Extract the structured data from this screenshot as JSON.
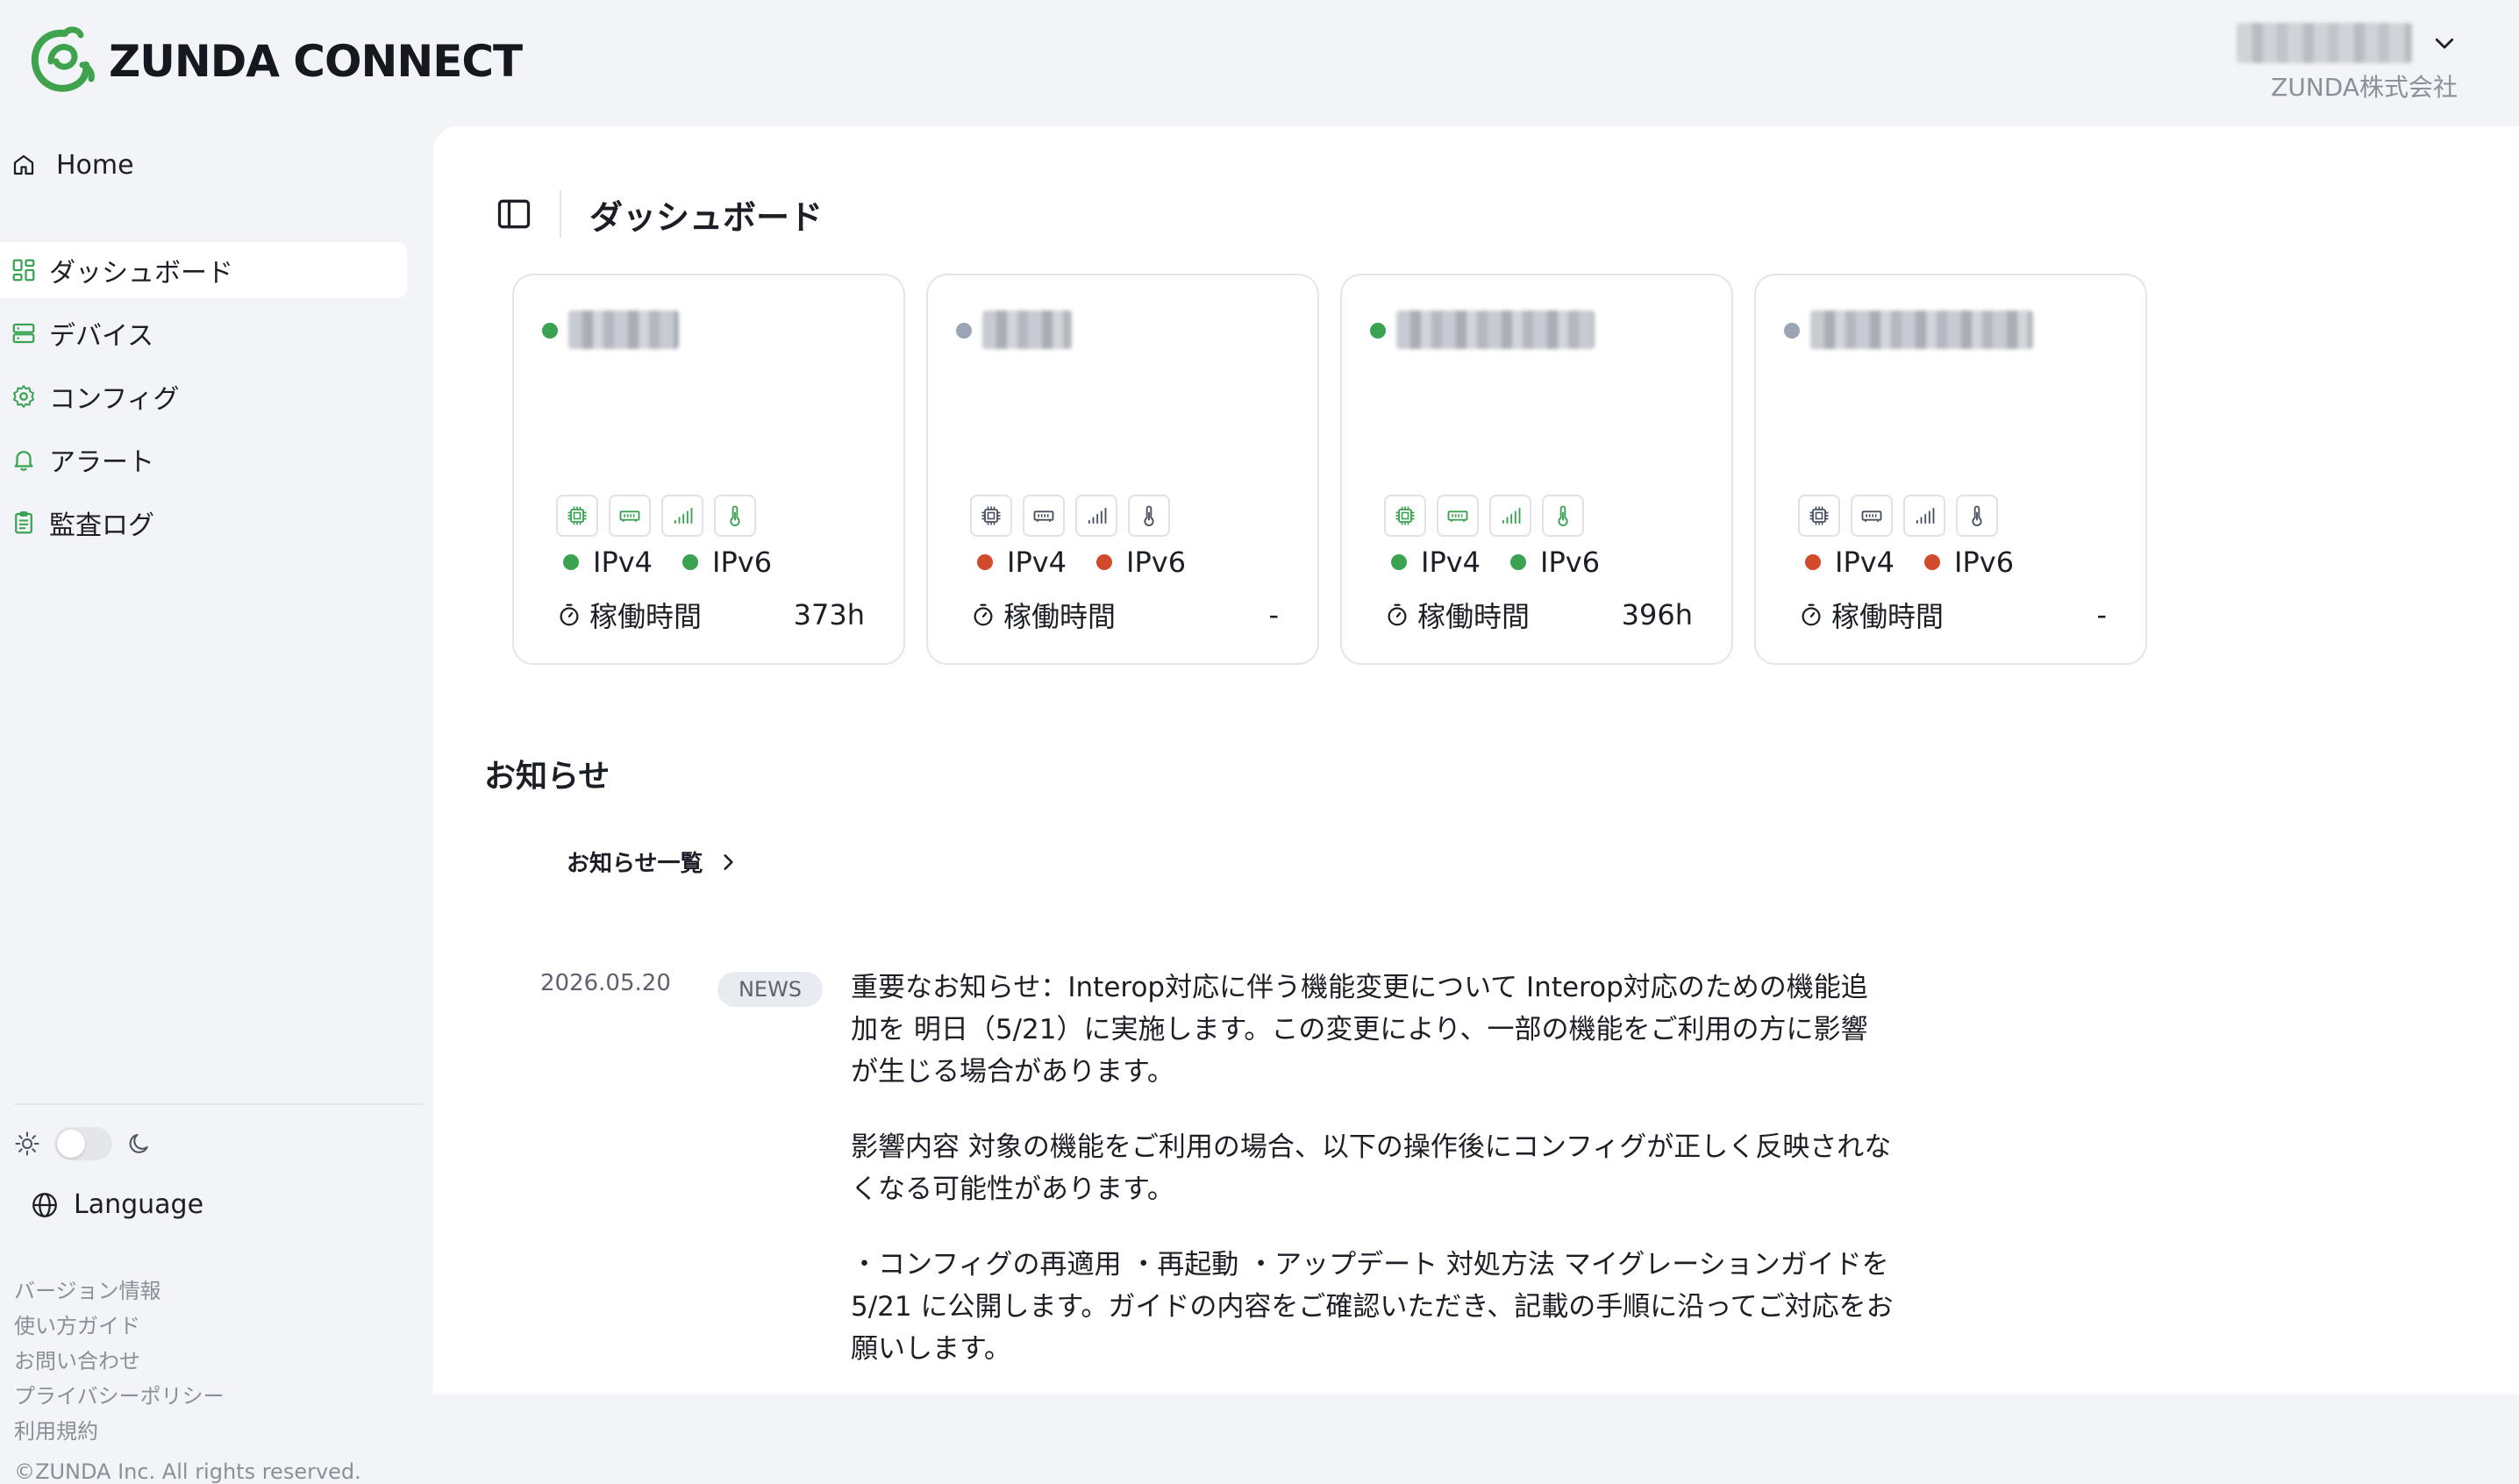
{
  "brand": {
    "name": "ZUNDA CONNECT",
    "color": "#3fa34d"
  },
  "user": {
    "company": "ZUNDA株式会社"
  },
  "nav": {
    "home": "Home",
    "items": [
      {
        "label": "ダッシュボード",
        "icon": "dashboard-icon",
        "active": true
      },
      {
        "label": "デバイス",
        "icon": "device-icon"
      },
      {
        "label": "コンフィグ",
        "icon": "gear-icon"
      },
      {
        "label": "アラート",
        "icon": "bell-icon"
      },
      {
        "label": "監査ログ",
        "icon": "clipboard-icon"
      }
    ]
  },
  "sidebar_footer": {
    "language": "Language",
    "links": [
      "バージョン情報",
      "使い方ガイド",
      "お問い合わせ",
      "プライバシーポリシー",
      "利用規約"
    ],
    "copyright": "©ZUNDA Inc. All rights reserved."
  },
  "page": {
    "title": "ダッシュボード"
  },
  "devices": [
    {
      "online": true,
      "ipv4_label": "IPv4",
      "ipv6_label": "IPv6",
      "ipv4_ok": true,
      "ipv6_ok": true,
      "uptime_label": "稼働時間",
      "uptime": "373h"
    },
    {
      "online": false,
      "ipv4_label": "IPv4",
      "ipv6_label": "IPv6",
      "ipv4_ok": false,
      "ipv6_ok": false,
      "uptime_label": "稼働時間",
      "uptime": "-"
    },
    {
      "online": true,
      "ipv4_label": "IPv4",
      "ipv6_label": "IPv6",
      "ipv4_ok": true,
      "ipv6_ok": true,
      "uptime_label": "稼働時間",
      "uptime": "396h"
    },
    {
      "online": false,
      "ipv4_label": "IPv4",
      "ipv6_label": "IPv6",
      "ipv4_ok": false,
      "ipv6_ok": false,
      "uptime_label": "稼働時間",
      "uptime": "-"
    }
  ],
  "colors": {
    "ok": "#3aa351",
    "error": "#d24a2c",
    "offline": "#9aa5b4",
    "icon_active": "#3aa351",
    "icon_inactive": "#4a5260"
  },
  "news": {
    "title": "お知らせ",
    "list_link": "お知らせ一覧",
    "items": [
      {
        "date": "2026.05.20",
        "badge": "NEWS",
        "paragraphs": [
          "重要なお知らせ：Interop対応に伴う機能変更について Interop対応のための機能追加を 明日（5/21）に実施します。この変更により、一部の機能をご利用の方に影響が生じる場合があります。",
          "影響内容 対象の機能をご利用の場合、以下の操作後にコンフィグが正しく反映されなくなる可能性があります。",
          "・コンフィグの再適用 ・再起動 ・アップデート 対処方法 マイグレーションガイドを 5/21 に公開します。ガイドの内容をご確認いただき、記載の手順に沿ってご対応をお願いします。"
        ]
      }
    ]
  }
}
